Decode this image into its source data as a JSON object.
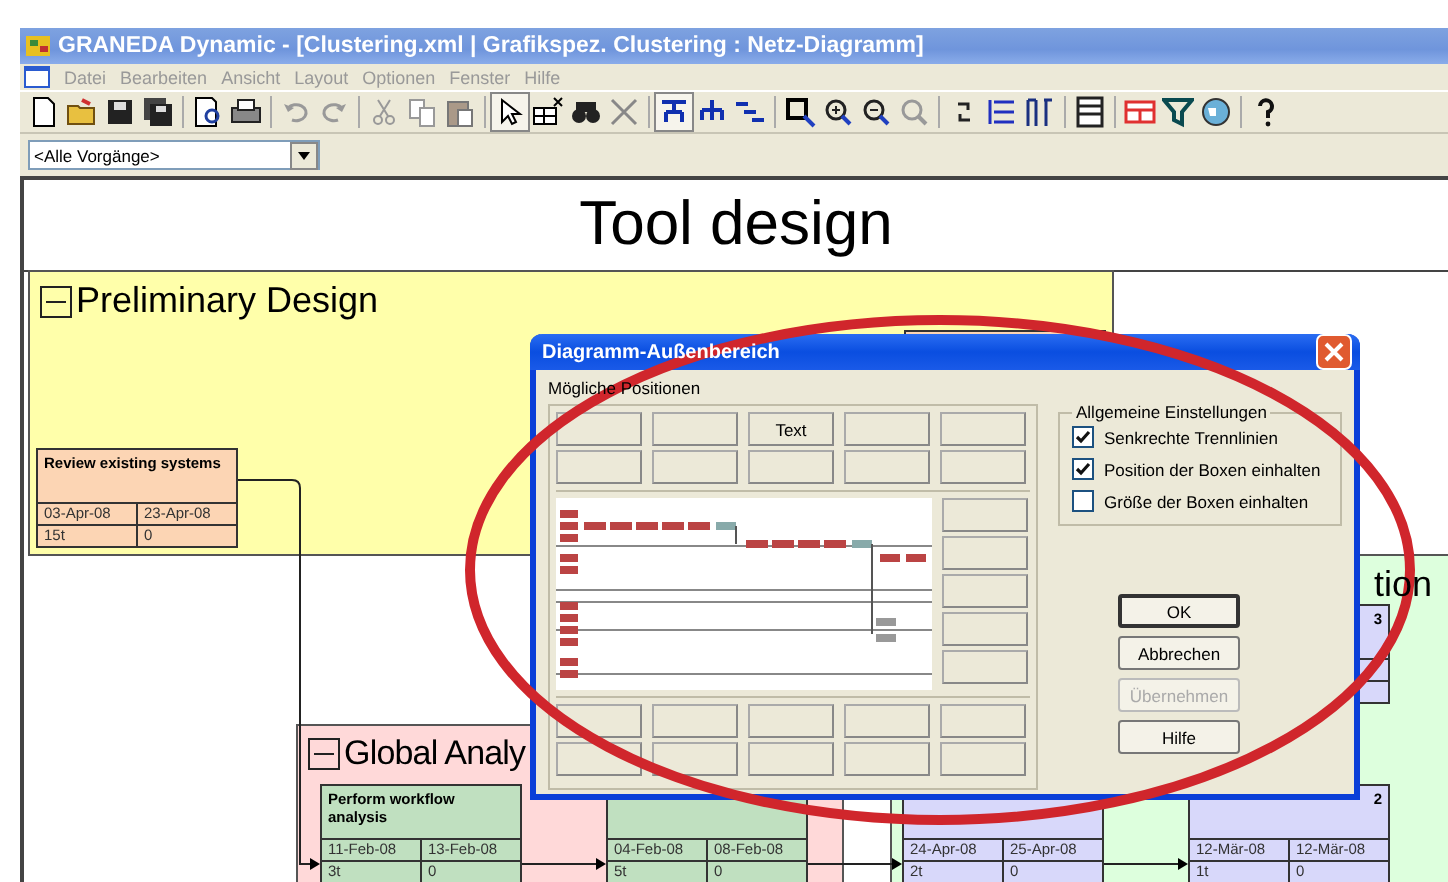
{
  "window": {
    "title": "GRANEDA Dynamic - [Clustering.xml |  Grafikspez. Clustering : Netz-Diagramm]"
  },
  "menu": [
    {
      "label": "Datei",
      "disabled": true
    },
    {
      "label": "Bearbeiten",
      "disabled": true
    },
    {
      "label": "Ansicht",
      "disabled": true
    },
    {
      "label": "Layout",
      "disabled": true
    },
    {
      "label": "Optionen",
      "disabled": true
    },
    {
      "label": "Fenster",
      "disabled": true
    },
    {
      "label": "Hilfe",
      "disabled": true
    }
  ],
  "filter": {
    "value": "<Alle Vorgänge>"
  },
  "diagram": {
    "title": "Tool design",
    "groups": [
      {
        "name": "Preliminary Design",
        "color": "#ffffaa",
        "expanded": true
      },
      {
        "name": "Global Analy",
        "color": "#ffd9d9",
        "expanded": true
      },
      {
        "name": "tion",
        "color": "#ddffdd"
      }
    ],
    "tasks": [
      {
        "name": "Review existing systems",
        "start": "03-Apr-08",
        "finish": "23-Apr-08",
        "duration": "15t",
        "slack": "0",
        "color": "#fcd5b4"
      },
      {
        "name": "Perform workflow analysis",
        "start": "11-Feb-08",
        "finish": "13-Feb-08",
        "duration": "3t",
        "slack": "0",
        "color": "#c0e0c0"
      },
      {
        "start": "04-Feb-08",
        "finish": "08-Feb-08",
        "duration": "5t",
        "slack": "0",
        "color": "#c0e0c0"
      },
      {
        "start": "24-Apr-08",
        "finish": "25-Apr-08",
        "duration": "2t",
        "slack": "0",
        "color": "#d8d8fa"
      },
      {
        "name": "3",
        "color": "#d8d8fa"
      },
      {
        "name": "2",
        "start": "12-Mär-08",
        "finish": "12-Mär-08",
        "duration": "1t",
        "slack": "0",
        "color": "#d8d8fa"
      },
      {
        "color": "#fcd5b4"
      }
    ]
  },
  "dialog": {
    "title": "Diagramm-Außenbereich",
    "section_label": "Mögliche Positionen",
    "top_slots": [
      {
        "kind": "empty"
      },
      {
        "kind": "empty"
      },
      {
        "kind": "label",
        "label": "Text"
      },
      {
        "kind": "empty"
      },
      {
        "kind": "empty"
      },
      {
        "kind": "empty"
      },
      {
        "kind": "empty"
      },
      {
        "kind": "empty"
      },
      {
        "kind": "empty"
      },
      {
        "kind": "empty"
      }
    ],
    "settings": {
      "title": "Allgemeine Einstellungen",
      "options": [
        {
          "label": "Senkrechte Trennlinien",
          "checked": true
        },
        {
          "label": "Position der Boxen einhalten",
          "checked": true
        },
        {
          "label": "Größe der Boxen einhalten",
          "checked": false
        }
      ]
    },
    "buttons": [
      {
        "label": "OK",
        "default": true,
        "disabled": false
      },
      {
        "label": "Abbrechen",
        "default": false,
        "disabled": false
      },
      {
        "label": "Übernehmen",
        "default": false,
        "disabled": true
      },
      {
        "label": "Hilfe",
        "default": false,
        "disabled": false
      }
    ]
  }
}
